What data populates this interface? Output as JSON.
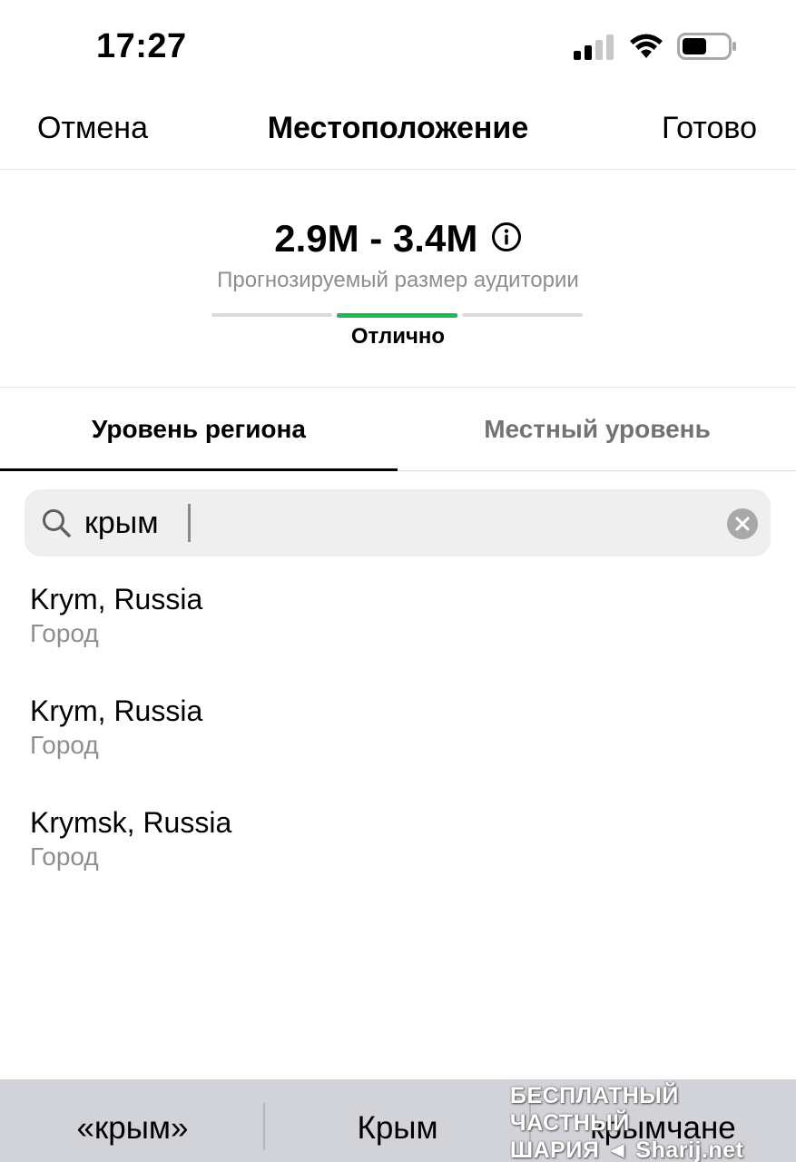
{
  "status": {
    "time": "17:27"
  },
  "nav": {
    "cancel_label": "Отмена",
    "title": "Местоположение",
    "done_label": "Готово"
  },
  "audience": {
    "range": "2.9M - 3.4M",
    "caption": "Прогнозируемый размер аудитории",
    "rating": "Отлично",
    "meter_active_segment": 2,
    "meter_segments": 3,
    "meter_active_color": "#1db954"
  },
  "tabs": [
    {
      "label": "Уровень региона",
      "selected": true
    },
    {
      "label": "Местный уровень",
      "selected": false
    }
  ],
  "search": {
    "value": "крым"
  },
  "results": [
    {
      "name": "Krym, Russia",
      "type": "Город"
    },
    {
      "name": "Krym, Russia",
      "type": "Город"
    },
    {
      "name": "Krymsk, Russia",
      "type": "Город"
    }
  ],
  "keyboard_suggestions": [
    "«крым»",
    "Крым",
    "крымчане"
  ],
  "watermark": {
    "line1": "БЕСПЛАТНЫЙ ЧАСТНЫЙ",
    "line2": "ШАРИЯ ◄ Sharij.net"
  },
  "icons": {
    "signal": "cellular-signal-icon",
    "wifi": "wifi-icon",
    "battery": "battery-icon",
    "info": "info-icon",
    "search": "search-icon",
    "clear": "clear-icon"
  }
}
